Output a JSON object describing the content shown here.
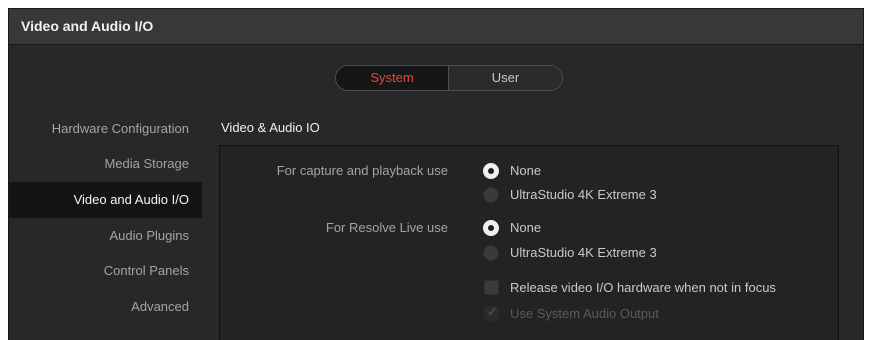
{
  "window": {
    "title": "Video and Audio I/O"
  },
  "tabs": {
    "system": "System",
    "user": "User",
    "active": "System"
  },
  "sidebar": {
    "items": [
      {
        "label": "Hardware Configuration"
      },
      {
        "label": "Media Storage"
      },
      {
        "label": "Video and Audio I/O"
      },
      {
        "label": "Audio Plugins"
      },
      {
        "label": "Control Panels"
      },
      {
        "label": "Advanced"
      }
    ],
    "active": "Video and Audio I/O"
  },
  "section": {
    "title": "Video & Audio IO",
    "capture": {
      "label": "For capture and playback use",
      "options": [
        "None",
        "UltraStudio 4K Extreme 3"
      ],
      "selected": "None"
    },
    "resolve_live": {
      "label": "For Resolve Live use",
      "options": [
        "None",
        "UltraStudio 4K Extreme 3"
      ],
      "selected": "None"
    },
    "release_video": {
      "label": "Release video I/O hardware when not in focus",
      "checked": false
    },
    "system_audio": {
      "label": "Use System Audio Output",
      "checked": true,
      "enabled": false
    }
  },
  "colors": {
    "accent": "#e8483d",
    "background": "#28282a",
    "panel": "#232325",
    "sidebar_active": "#141415"
  },
  "icons": {
    "radio_selected": "radio-selected-icon",
    "radio_unselected": "radio-unselected-icon",
    "checkbox": "checkbox-icon",
    "checkmark": "checkmark-icon"
  }
}
